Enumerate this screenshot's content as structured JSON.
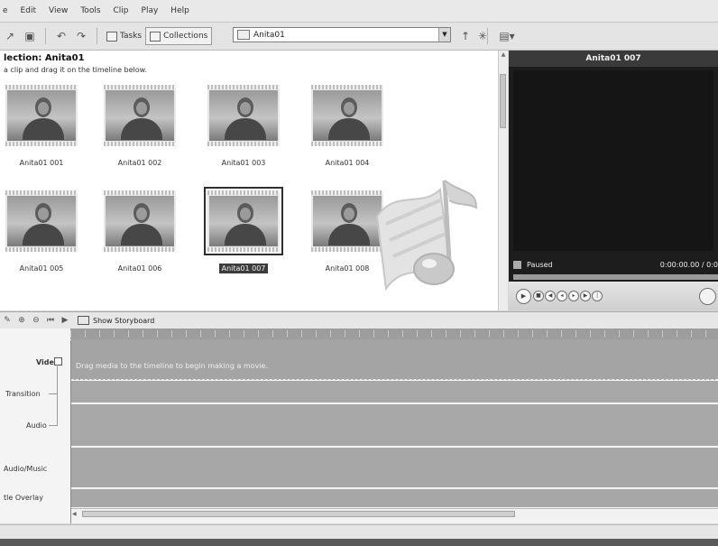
{
  "menu": [
    "e",
    "Edit",
    "View",
    "Tools",
    "Clip",
    "Play",
    "Help"
  ],
  "toolbar": {
    "tasks_label": "Tasks",
    "collections_label": "Collections",
    "collection_value": "Anita01"
  },
  "collection": {
    "heading": "lection: Anita01",
    "hint": "a clip and drag it on the timeline below.",
    "clips": [
      {
        "label": "Anita01 001",
        "selected": false
      },
      {
        "label": "Anita01 002",
        "selected": false
      },
      {
        "label": "Anita01 003",
        "selected": false
      },
      {
        "label": "Anita01 004",
        "selected": false
      },
      {
        "label": "Anita01 005",
        "selected": false
      },
      {
        "label": "Anita01 006",
        "selected": false
      },
      {
        "label": "Anita01 007",
        "selected": true
      },
      {
        "label": "Anita01 008",
        "selected": false
      }
    ]
  },
  "monitor": {
    "title": "Anita01 007",
    "status": "Paused",
    "time": "0:00:00.00 / 0:0"
  },
  "timeline_toolbar": {
    "storyboard_label": "Show Storyboard"
  },
  "timeline": {
    "tracks": {
      "video": "Video",
      "transition": "Transition",
      "audio": "Audio",
      "audio_music": "Audio/Music",
      "title_overlay": "tle Overlay"
    },
    "video_hint": "Drag media to the timeline to begin making a movie."
  }
}
